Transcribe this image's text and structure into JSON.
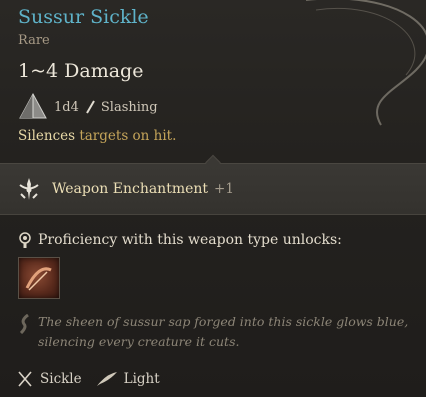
{
  "item": {
    "name": "Sussur Sickle",
    "rarity": "Rare",
    "damage": "1~4 Damage",
    "dice": "1d4",
    "damage_type": "Slashing",
    "effect_keyword": "Silences",
    "effect_rest": " targets on hit."
  },
  "enchantment": {
    "label": "Weapon Enchantment",
    "bonus": "+1"
  },
  "proficiency": {
    "label": "Proficiency with this weapon type unlocks:"
  },
  "flavor": "The sheen of sussur sap forged into this sickle glows blue, silencing every creature it cuts.",
  "footer": {
    "weapon_type": "Sickle",
    "weight_class": "Light"
  },
  "colors": {
    "title": "#5fb3c9",
    "keyword": "#e7d8a6",
    "effect": "#c5a55a",
    "rarity": "#a79a86"
  },
  "icons": [
    "die-d4-icon",
    "slashing-icon",
    "weapon-enchantment-icon",
    "proficiency-icon",
    "weapon-action-icon",
    "flavor-quill-icon",
    "sickle-icon",
    "light-feather-icon"
  ]
}
